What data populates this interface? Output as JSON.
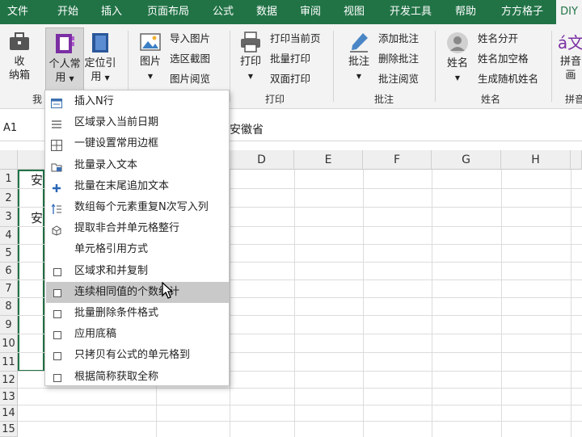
{
  "tabs": [
    "文件",
    "开始",
    "插入",
    "页面布局",
    "公式",
    "数据",
    "审阅",
    "视图",
    "开发工具",
    "帮助",
    "方方格子",
    "DIY"
  ],
  "ribbon": {
    "collect_label": "收\n纳箱",
    "personal_label": "个人常\n用",
    "locate_label": "定位引\n用",
    "picture_label": "图片",
    "import_picture": "导入图片",
    "select_screenshot": "选区截图",
    "picture_browse": "图片阅览",
    "print_label": "打印",
    "print_current": "打印当前页",
    "batch_print": "批量打印",
    "duplex_print": "双面打印",
    "comment_label": "批注",
    "add_comment": "添加批注",
    "delete_comment": "删除批注",
    "comment_browse": "批注阅览",
    "name_label": "姓名",
    "name_split": "姓名分开",
    "name_space": "姓名加空格",
    "random_name": "生成随机姓名",
    "pinyin_label": "拼音\n画",
    "groups": {
      "mine": "我",
      "print": "打印",
      "comment": "批注",
      "name": "姓名",
      "pinyin": "拼音"
    }
  },
  "formula_bar": {
    "cell_ref": "A1",
    "content": "安徽省"
  },
  "columns": [
    "D",
    "E",
    "F",
    "G",
    "H"
  ],
  "rows": [
    "1",
    "2",
    "3",
    "4",
    "5",
    "6",
    "7",
    "8",
    "9",
    "10",
    "11",
    "12",
    "13",
    "14",
    "15"
  ],
  "cells": {
    "a1_partial": "安",
    "a3_partial": "安"
  },
  "menu": {
    "items": [
      {
        "label": "插入N行",
        "icon": "insert-rows-icon"
      },
      {
        "label": "区域录入当前日期",
        "icon": "date-list-icon"
      },
      {
        "label": "一键设置常用边框",
        "icon": "border-grid-icon"
      },
      {
        "label": "批量录入文本",
        "icon": "folder-text-icon"
      },
      {
        "label": "批量在末尾追加文本",
        "icon": "plus-icon"
      },
      {
        "label": "数组每个元素重复N次写入列",
        "icon": "repeat-list-icon"
      },
      {
        "label": "提取非合并单元格整行",
        "icon": "cube-icon"
      },
      {
        "label": "单元格引用方式",
        "icon": ""
      },
      {
        "label": "区域求和并复制",
        "icon": "checkbox-icon"
      },
      {
        "label": "连续相同值的个数统计",
        "icon": "checkbox-icon",
        "highlighted": true
      },
      {
        "label": "批量删除条件格式",
        "icon": "checkbox-icon"
      },
      {
        "label": "应用底稿",
        "icon": "checkbox-icon"
      },
      {
        "label": "只拷贝有公式的单元格到",
        "icon": "checkbox-icon"
      },
      {
        "label": "根据简称获取全称",
        "icon": "checkbox-icon"
      }
    ]
  },
  "colors": {
    "accent": "#217346",
    "highlight": "#c9c9c9"
  }
}
